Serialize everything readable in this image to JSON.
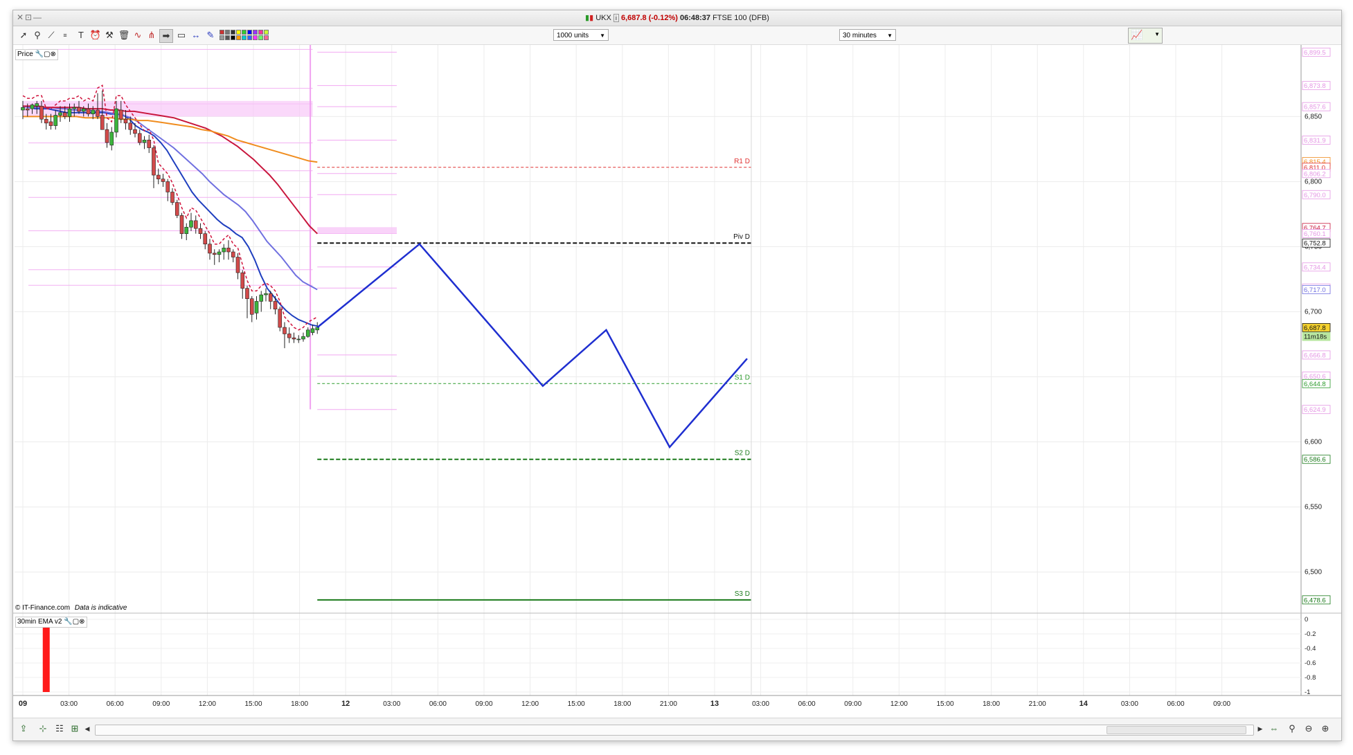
{
  "window": {
    "controls": [
      "✕",
      "⊡",
      "—"
    ],
    "title": {
      "symbol": "UKX",
      "price_change": "6,687.8 (-0.12%)",
      "time": "06:48:37",
      "instrument": "FTSE 100 (DFB)"
    }
  },
  "toolbar": {
    "units_select": "1000 units",
    "interval_select": "30 minutes",
    "tool_icons": [
      "cursor-icon",
      "zoom-icon",
      "trend-icon",
      "fib-icon",
      "text-icon",
      "alarm-icon",
      "tools-icon",
      "trash-icon",
      "wave-icon",
      "pitchfork-icon",
      "arrow-icon",
      "shape-icon",
      "hline-icon",
      "pen-icon"
    ],
    "palette_colors": [
      "#cc3333",
      "#999999",
      "#777777",
      "#555555",
      "#333333",
      "#000000",
      "#ffff00",
      "#ff9900",
      "#33cc33",
      "#00cccc",
      "#0000ff",
      "#3366ff",
      "#9933ff",
      "#ff33ff",
      "#ff3399",
      "#66ff66",
      "#ccff33",
      "#ff6699"
    ]
  },
  "price_pane": {
    "label": "Price",
    "watermark": "© IT-Finance.com",
    "watermark_note": "Data is indicative"
  },
  "indicator_pane": {
    "label": "30min EMA v2",
    "ticks": [
      "0",
      "-0.2",
      "-0.4",
      "-0.6",
      "-0.8",
      "-1"
    ]
  },
  "chart_data": {
    "type": "candlestick",
    "instrument": "FTSE 100 (DFB)",
    "interval": "30 minutes",
    "y_axis": {
      "range": [
        6470,
        6905
      ],
      "ticks": [
        6500,
        6550,
        6600,
        6650,
        6700,
        6750,
        6800,
        6850
      ],
      "tick_labels": [
        "6,500",
        "6,550",
        "6,600",
        "6,650",
        "6,700",
        "6,750",
        "6,800",
        "6,850"
      ]
    },
    "x_axis": {
      "tick_labels": [
        "09",
        "03:00",
        "06:00",
        "09:00",
        "12:00",
        "15:00",
        "18:00",
        "12",
        "03:00",
        "06:00",
        "09:00",
        "12:00",
        "15:00",
        "18:00",
        "21:00",
        "13",
        "03:00",
        "06:00",
        "09:00",
        "12:00",
        "15:00",
        "18:00",
        "21:00",
        "14",
        "03:00",
        "06:00",
        "09:00"
      ],
      "day_labels": [
        "09",
        "12",
        "13",
        "14"
      ]
    },
    "candles": [
      {
        "o": 6855,
        "h": 6862,
        "l": 6848,
        "c": 6857
      },
      {
        "o": 6856,
        "h": 6860,
        "l": 6850,
        "c": 6855
      },
      {
        "o": 6856,
        "h": 6860,
        "l": 6852,
        "c": 6859
      },
      {
        "o": 6858,
        "h": 6862,
        "l": 6852,
        "c": 6860
      },
      {
        "o": 6858,
        "h": 6862,
        "l": 6845,
        "c": 6848
      },
      {
        "o": 6848,
        "h": 6852,
        "l": 6840,
        "c": 6845
      },
      {
        "o": 6846,
        "h": 6852,
        "l": 6840,
        "c": 6843
      },
      {
        "o": 6843,
        "h": 6855,
        "l": 6840,
        "c": 6851
      },
      {
        "o": 6851,
        "h": 6858,
        "l": 6846,
        "c": 6853
      },
      {
        "o": 6853,
        "h": 6858,
        "l": 6848,
        "c": 6850
      },
      {
        "o": 6850,
        "h": 6860,
        "l": 6846,
        "c": 6856
      },
      {
        "o": 6856,
        "h": 6860,
        "l": 6850,
        "c": 6857
      },
      {
        "o": 6857,
        "h": 6862,
        "l": 6852,
        "c": 6854
      },
      {
        "o": 6854,
        "h": 6858,
        "l": 6850,
        "c": 6856
      },
      {
        "o": 6856,
        "h": 6860,
        "l": 6850,
        "c": 6852
      },
      {
        "o": 6852,
        "h": 6858,
        "l": 6848,
        "c": 6855
      },
      {
        "o": 6855,
        "h": 6868,
        "l": 6848,
        "c": 6850
      },
      {
        "o": 6851,
        "h": 6870,
        "l": 6840,
        "c": 6840
      },
      {
        "o": 6840,
        "h": 6845,
        "l": 6826,
        "c": 6830
      },
      {
        "o": 6828,
        "h": 6842,
        "l": 6824,
        "c": 6838
      },
      {
        "o": 6838,
        "h": 6862,
        "l": 6834,
        "c": 6856
      },
      {
        "o": 6855,
        "h": 6862,
        "l": 6845,
        "c": 6848
      },
      {
        "o": 6848,
        "h": 6855,
        "l": 6840,
        "c": 6845
      },
      {
        "o": 6845,
        "h": 6850,
        "l": 6836,
        "c": 6840
      },
      {
        "o": 6840,
        "h": 6845,
        "l": 6834,
        "c": 6837
      },
      {
        "o": 6837,
        "h": 6840,
        "l": 6828,
        "c": 6830
      },
      {
        "o": 6830,
        "h": 6835,
        "l": 6825,
        "c": 6832
      },
      {
        "o": 6832,
        "h": 6836,
        "l": 6822,
        "c": 6826
      },
      {
        "o": 6826,
        "h": 6828,
        "l": 6795,
        "c": 6805
      },
      {
        "o": 6805,
        "h": 6810,
        "l": 6798,
        "c": 6802
      },
      {
        "o": 6802,
        "h": 6806,
        "l": 6796,
        "c": 6800
      },
      {
        "o": 6800,
        "h": 6802,
        "l": 6785,
        "c": 6792
      },
      {
        "o": 6792,
        "h": 6795,
        "l": 6782,
        "c": 6784
      },
      {
        "o": 6784,
        "h": 6786,
        "l": 6772,
        "c": 6774
      },
      {
        "o": 6774,
        "h": 6776,
        "l": 6756,
        "c": 6760
      },
      {
        "o": 6760,
        "h": 6768,
        "l": 6755,
        "c": 6765
      },
      {
        "o": 6765,
        "h": 6776,
        "l": 6762,
        "c": 6770
      },
      {
        "o": 6770,
        "h": 6774,
        "l": 6760,
        "c": 6764
      },
      {
        "o": 6764,
        "h": 6768,
        "l": 6756,
        "c": 6760
      },
      {
        "o": 6760,
        "h": 6762,
        "l": 6748,
        "c": 6752
      },
      {
        "o": 6752,
        "h": 6756,
        "l": 6740,
        "c": 6745
      },
      {
        "o": 6745,
        "h": 6748,
        "l": 6736,
        "c": 6744
      },
      {
        "o": 6744,
        "h": 6748,
        "l": 6738,
        "c": 6746
      },
      {
        "o": 6746,
        "h": 6752,
        "l": 6740,
        "c": 6749
      },
      {
        "o": 6749,
        "h": 6755,
        "l": 6740,
        "c": 6746
      },
      {
        "o": 6746,
        "h": 6748,
        "l": 6738,
        "c": 6742
      },
      {
        "o": 6742,
        "h": 6745,
        "l": 6725,
        "c": 6730
      },
      {
        "o": 6730,
        "h": 6732,
        "l": 6710,
        "c": 6718
      },
      {
        "o": 6718,
        "h": 6720,
        "l": 6695,
        "c": 6710
      },
      {
        "o": 6710,
        "h": 6712,
        "l": 6692,
        "c": 6698
      },
      {
        "o": 6699,
        "h": 6712,
        "l": 6694,
        "c": 6708
      },
      {
        "o": 6708,
        "h": 6716,
        "l": 6700,
        "c": 6713
      },
      {
        "o": 6713,
        "h": 6718,
        "l": 6708,
        "c": 6714
      },
      {
        "o": 6714,
        "h": 6716,
        "l": 6702,
        "c": 6708
      },
      {
        "o": 6708,
        "h": 6712,
        "l": 6698,
        "c": 6702
      },
      {
        "o": 6702,
        "h": 6704,
        "l": 6685,
        "c": 6688
      },
      {
        "o": 6688,
        "h": 6692,
        "l": 6672,
        "c": 6683
      },
      {
        "o": 6683,
        "h": 6688,
        "l": 6676,
        "c": 6680
      },
      {
        "o": 6680,
        "h": 6684,
        "l": 6676,
        "c": 6679
      },
      {
        "o": 6679,
        "h": 6682,
        "l": 6676,
        "c": 6679
      },
      {
        "o": 6679,
        "h": 6684,
        "l": 6677,
        "c": 6681
      },
      {
        "o": 6681,
        "h": 6688,
        "l": 6680,
        "c": 6686
      },
      {
        "o": 6684,
        "h": 6690,
        "l": 6682,
        "c": 6687
      },
      {
        "o": 6686,
        "h": 6692,
        "l": 6683,
        "c": 6688
      }
    ],
    "moving_averages": [
      {
        "color": "#1f3fbf",
        "values": [
          6858,
          6857,
          6856,
          6856,
          6856,
          6855,
          6854,
          6853,
          6853,
          6853,
          6853,
          6853,
          6853,
          6853,
          6852,
          6852,
          6851,
          6848,
          6843,
          6840,
          6838,
          6835,
          6830,
          6824,
          6816,
          6808,
          6800,
          6792,
          6786,
          6781,
          6776,
          6771,
          6767,
          6764,
          6760,
          6757,
          6750,
          6740,
          6728,
          6718,
          6712,
          6706,
          6701,
          6697,
          6694,
          6692,
          6690,
          6689
        ]
      },
      {
        "color": "#7070e0",
        "values": [
          6858,
          6857,
          6857,
          6857,
          6857,
          6856,
          6856,
          6855,
          6855,
          6855,
          6854,
          6854,
          6853,
          6852,
          6851,
          6849,
          6846,
          6842,
          6838,
          6834,
          6830,
          6826,
          6821,
          6816,
          6811,
          6806,
          6800,
          6795,
          6790,
          6786,
          6782,
          6777,
          6770,
          6762,
          6754,
          6748,
          6742,
          6735,
          6728,
          6723,
          6720,
          6717
        ]
      },
      {
        "color": "#c8163c",
        "values": [
          6858,
          6858,
          6858,
          6857,
          6857,
          6857,
          6857,
          6857,
          6856,
          6856,
          6856,
          6855,
          6855,
          6854,
          6854,
          6853,
          6852,
          6851,
          6850,
          6849,
          6847,
          6845,
          6843,
          6841,
          6838,
          6835,
          6831,
          6827,
          6822,
          6817,
          6811,
          6805,
          6798,
          6790,
          6782,
          6774,
          6766,
          6760
        ]
      },
      {
        "color": "#f08c1e",
        "values": [
          6850,
          6850,
          6850,
          6850,
          6850,
          6850,
          6850,
          6849,
          6849,
          6849,
          6849,
          6848,
          6848,
          6847,
          6847,
          6846,
          6845,
          6844,
          6843,
          6842,
          6840,
          6839,
          6837,
          6835,
          6832,
          6830,
          6828,
          6826,
          6824,
          6822,
          6820,
          6818,
          6816,
          6815
        ]
      }
    ],
    "pivot_levels": [
      {
        "name": "R1 D",
        "value": 6811.0,
        "color": "#e03030"
      },
      {
        "name": "Piv D",
        "value": 6752.8,
        "color": "#111111"
      },
      {
        "name": "S1 D",
        "value": 6644.8,
        "color": "#2b9a2b"
      },
      {
        "name": "S2 D",
        "value": 6586.6,
        "color": "#1a7a1a"
      },
      {
        "name": "S3 D",
        "value": 6478.6,
        "color": "#1a7a1a"
      }
    ],
    "right_axis_labels": [
      {
        "text": "6,899.5",
        "value": 6899.5,
        "color": "#e496e4"
      },
      {
        "text": "6,873.8",
        "value": 6873.8,
        "color": "#e496e4"
      },
      {
        "text": "6,857.6",
        "value": 6857.6,
        "color": "#e496e4"
      },
      {
        "text": "6,831.9",
        "value": 6831.9,
        "color": "#e496e4"
      },
      {
        "text": "6,815.4",
        "value": 6815.4,
        "color": "#f08c1e"
      },
      {
        "text": "6,811.0",
        "value": 6811.0,
        "color": "#e03030"
      },
      {
        "text": "6,806.2",
        "value": 6806.2,
        "color": "#e496e4"
      },
      {
        "text": "6,790.0",
        "value": 6790.0,
        "color": "#e496e4"
      },
      {
        "text": "6,764.7",
        "value": 6764.7,
        "color": "#c8163c"
      },
      {
        "text": "6,760.1",
        "value": 6760.1,
        "color": "#e496e4"
      },
      {
        "text": "6,752.8",
        "value": 6752.8,
        "color": "#111111"
      },
      {
        "text": "6,734.4",
        "value": 6734.4,
        "color": "#e496e4"
      },
      {
        "text": "6,718.2",
        "value": 6718.2,
        "color": "#e496e4"
      },
      {
        "text": "6,717.0",
        "value": 6717.0,
        "color": "#7070e0"
      },
      {
        "text": "6,687.8",
        "value": 6687.8,
        "color": "#111111",
        "highlight": true
      },
      {
        "text": "11m18s",
        "value": 6681.0,
        "color": "#111111",
        "timer": true
      },
      {
        "text": "6,666.8",
        "value": 6666.8,
        "color": "#e496e4"
      },
      {
        "text": "6,650.6",
        "value": 6650.6,
        "color": "#e496e4"
      },
      {
        "text": "6,644.8",
        "value": 6644.8,
        "color": "#2b9a2b"
      },
      {
        "text": "6,624.9",
        "value": 6624.9,
        "color": "#e496e4"
      },
      {
        "text": "6,586.6",
        "value": 6586.6,
        "color": "#1a7a1a"
      },
      {
        "text": "6,478.6",
        "value": 6478.6,
        "color": "#1a7a1a"
      }
    ],
    "forecast_path": [
      {
        "t": 5.9,
        "v": 6688
      },
      {
        "t": 7.35,
        "v": 6752
      },
      {
        "t": 9.1,
        "v": 6643
      },
      {
        "t": 10.0,
        "v": 6686
      },
      {
        "t": 10.9,
        "v": 6596
      },
      {
        "t": 12.0,
        "v": 6664
      }
    ],
    "indicator": {
      "name": "30min EMA v2",
      "bar_value": -1,
      "color": "#ff1a1a"
    }
  }
}
